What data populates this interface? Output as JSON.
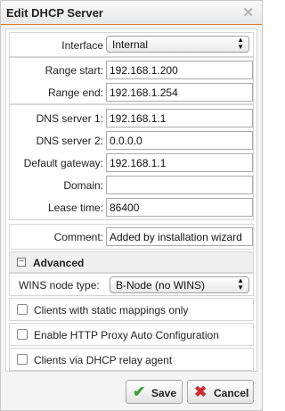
{
  "dialog": {
    "title": "Edit DHCP Server",
    "close_glyph": "✕"
  },
  "fields": {
    "interface": {
      "label": "Interface",
      "value": "Internal"
    },
    "range_start": {
      "label": "Range start:",
      "value": "192.168.1.200"
    },
    "range_end": {
      "label": "Range end:",
      "value": "192.168.1.254"
    },
    "dns1": {
      "label": "DNS server 1:",
      "value": "192.168.1.1"
    },
    "dns2": {
      "label": "DNS server 2:",
      "value": "0.0.0.0"
    },
    "gateway": {
      "label": "Default gateway:",
      "value": "192.168.1.1"
    },
    "domain": {
      "label": "Domain:",
      "value": ""
    },
    "lease": {
      "label": "Lease time:",
      "value": "86400"
    },
    "comment": {
      "label": "Comment:",
      "value": "Added by installation wizard"
    }
  },
  "advanced": {
    "title": "Advanced",
    "toggle_glyph": "−",
    "wins": {
      "label": "WINS node type:",
      "value": "B-Node (no WINS)"
    },
    "options": [
      {
        "label": "Clients with static mappings only",
        "checked": false
      },
      {
        "label": "Enable HTTP Proxy Auto Configuration",
        "checked": false
      },
      {
        "label": "Clients via DHCP relay agent",
        "checked": false
      }
    ]
  },
  "buttons": {
    "save": {
      "label": "Save",
      "icon": "checkmark-icon"
    },
    "cancel": {
      "label": "Cancel",
      "icon": "x-icon"
    }
  },
  "colors": {
    "accent": "#e07a2a",
    "save_icon": "#3aa335",
    "cancel_icon": "#d22b2b"
  }
}
